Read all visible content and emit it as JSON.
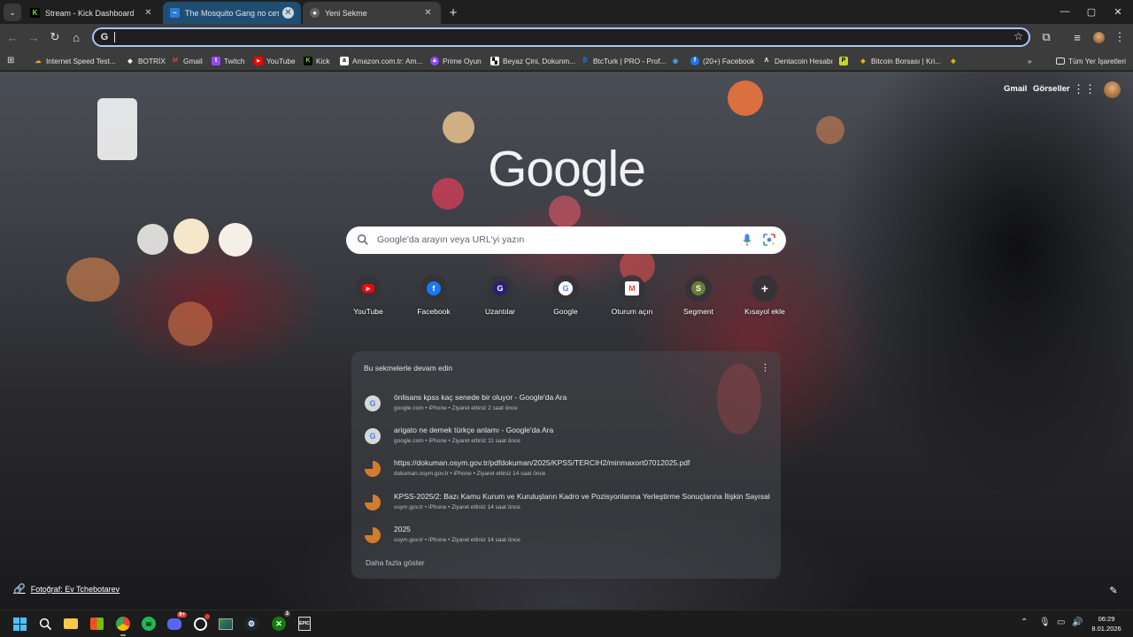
{
  "tabs": [
    {
      "title": "Stream - Kick Dashboard",
      "favicon": "kick-icon",
      "color": "#53fc18"
    },
    {
      "title": "The Mosquito Gang по сети 6в",
      "favicon": "game-icon",
      "color": "#2b7bd8"
    },
    {
      "title": "Yeni Sekme",
      "favicon": "chrome-icon",
      "color": "#e3e3e3"
    }
  ],
  "window": {
    "minimize": "—",
    "maximize": "▢",
    "close": "✕"
  },
  "omnibox": {
    "value": ""
  },
  "bookmarks": [
    {
      "label": "Internet Speed Test...",
      "icon": "speedtest-icon",
      "color": "#f5a623"
    },
    {
      "label": "BOTRİX",
      "icon": "botrix-icon",
      "color": "#ffffff"
    },
    {
      "label": "Gmail",
      "icon": "gmail-icon",
      "color": "#ea4335"
    },
    {
      "label": "Twitch",
      "icon": "twitch-icon",
      "color": "#9146ff"
    },
    {
      "label": "YouTube",
      "icon": "youtube-icon",
      "color": "#ff0000"
    },
    {
      "label": "Kick",
      "icon": "kick-icon",
      "color": "#53fc18"
    },
    {
      "label": "Amazon.com.tr: Am...",
      "icon": "amazon-icon",
      "color": "#ffffff"
    },
    {
      "label": "Prime Oyun",
      "icon": "prime-gaming-icon",
      "color": "#9146ff"
    },
    {
      "label": "Beyaz Çini, Dokunm...",
      "icon": "tile-icon",
      "color": "#ffffff"
    },
    {
      "label": "BtcTurk | PRO - Prof...",
      "icon": "btcturk-icon",
      "color": "#1a73e8"
    },
    {
      "label": "",
      "icon": "crypto-icon",
      "color": "#4aa3df"
    },
    {
      "label": "(20+) Facebook",
      "icon": "facebook-icon",
      "color": "#1877f2"
    },
    {
      "label": "Dentacoin Hesabı",
      "icon": "dentacoin-icon",
      "color": "#ffffff"
    },
    {
      "label": "",
      "icon": "p-icon",
      "color": "#c6d82b"
    },
    {
      "label": "Bitcoin Borsası | Kri...",
      "icon": "binance-icon",
      "color": "#f0b90b"
    },
    {
      "label": "",
      "icon": "binance-icon",
      "color": "#f0b90b"
    }
  ],
  "bookmarks_more": "»",
  "all_bookmarks": "Tüm Yer İşaretleri",
  "ntp": {
    "gmail": "Gmail",
    "images": "Görseller",
    "logo": "Google",
    "search_placeholder": "Google'da arayın veya URL'yi yazın",
    "shortcuts": [
      {
        "label": "YouTube",
        "icon": "youtube-icon",
        "color": "#ff0000",
        "glyph": "▶"
      },
      {
        "label": "Facebook",
        "icon": "facebook-icon",
        "color": "#1877f2",
        "glyph": "f"
      },
      {
        "label": "Uzantılar",
        "icon": "extension-g-icon",
        "color": "#2a1f7a",
        "glyph": "G"
      },
      {
        "label": "Google",
        "icon": "google-icon",
        "color": "#ffffff",
        "glyph": "G"
      },
      {
        "label": "Oturum açın",
        "icon": "gmail-icon",
        "color": "#ffffff",
        "glyph": "M"
      },
      {
        "label": "Segment",
        "icon": "segment-icon",
        "color": "#6b7c3a",
        "glyph": "S"
      },
      {
        "label": "Kısayol ekle",
        "icon": "add-icon",
        "color": "#3c3c3c",
        "glyph": "+"
      }
    ],
    "continue": {
      "title": "Bu sekmelerle devam edin",
      "more": "⋮",
      "items": [
        {
          "title": "önlisans kpss kaç senede bir oluyor - Google'da Ara",
          "sub": "google.com • iPhone • Ziyaret ettiniz 2 saat önce",
          "icon": "google-icon"
        },
        {
          "title": "arigato ne demek türkçe anlamı - Google'da Ara",
          "sub": "google.com • iPhone • Ziyaret ettiniz 11 saat önce",
          "icon": "google-icon"
        },
        {
          "title": "https://dokuman.osym.gov.tr/pdfdokuman/2025/KPSS/TERCIH2/minmaxort07012025.pdf",
          "sub": "dokuman.osym.gov.tr • iPhone • Ziyaret ettiniz 14 saat önce",
          "icon": "osym-icon"
        },
        {
          "title": "KPSS-2025/2: Bazı Kamu Kurum ve Kuruluşların Kadro ve Pozisyonlarına Yerleştirme Sonuçlarına İlişkin Sayısal...",
          "sub": "osym.gov.tr • iPhone • Ziyaret ettiniz 14 saat önce",
          "icon": "osym-icon"
        },
        {
          "title": "2025",
          "sub": "osym.gov.tr • iPhone • Ziyaret ettiniz 14 saat önce",
          "icon": "osym-icon"
        }
      ],
      "show_more": "Daha fazla göster"
    },
    "photo_credit": "Fotoğraf: Ev Tchebotarev"
  },
  "taskbar": {
    "time": "06:29",
    "date": "8.01.2026",
    "discord_badge": "9+",
    "xbox_badge": "3",
    "epic": "EPIC"
  }
}
